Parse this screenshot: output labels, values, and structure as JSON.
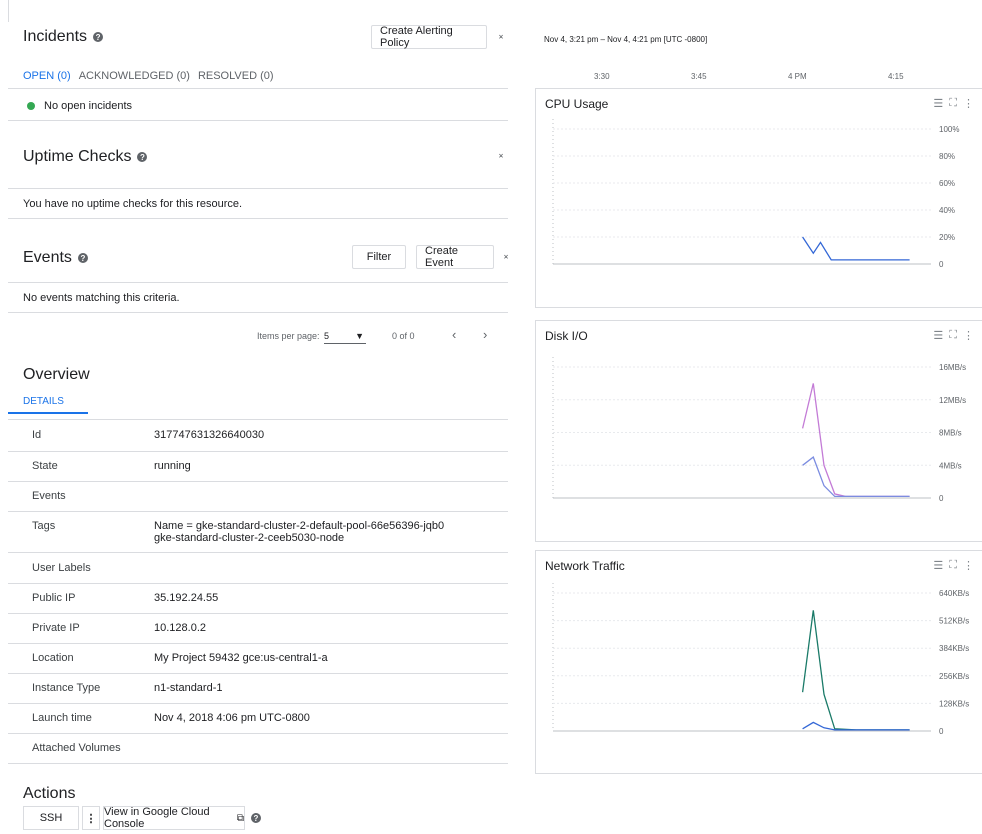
{
  "incidents": {
    "title": "Incidents",
    "create_policy_label": "Create Alerting Policy",
    "tabs": [
      "OPEN (0)",
      "ACKNOWLEDGED (0)",
      "RESOLVED (0)"
    ],
    "status_text": "No open incidents",
    "status_color": "#34a853"
  },
  "uptime": {
    "title": "Uptime Checks",
    "message": "You have no uptime checks for this resource."
  },
  "events": {
    "title": "Events",
    "filter_label": "Filter",
    "create_event_label": "Create Event",
    "message": "No events matching this criteria.",
    "pager": {
      "items_per_page_label": "Items per page:",
      "items_per_page_value": "5",
      "range": "0 of 0"
    }
  },
  "overview": {
    "title": "Overview",
    "tab": "DETAILS",
    "rows": [
      {
        "key": "Id",
        "value": "317747631326640030"
      },
      {
        "key": "State",
        "value": "running"
      },
      {
        "key": "Events",
        "value": ""
      },
      {
        "key": "Tags",
        "value": "Name = gke-standard-cluster-2-default-pool-66e56396-jqb0",
        "value2": "gke-standard-cluster-2-ceeb5030-node"
      },
      {
        "key": "User Labels",
        "value": ""
      },
      {
        "key": "Public IP",
        "value": "35.192.24.55"
      },
      {
        "key": "Private IP",
        "value": "10.128.0.2"
      },
      {
        "key": "Location",
        "value": "My Project 59432 gce:us-central1-a"
      },
      {
        "key": "Instance Type",
        "value": "n1-standard-1"
      },
      {
        "key": "Launch time",
        "value": "Nov 4, 2018 4:06 pm UTC-0800"
      },
      {
        "key": "Attached Volumes",
        "value": ""
      }
    ]
  },
  "actions": {
    "title": "Actions",
    "ssh_label": "SSH",
    "more_label": "⋮",
    "console_label": "View in Google Cloud Console"
  },
  "time_range": "Nov 4, 3:21 pm – Nov 4, 4:21 pm [UTC -0800]",
  "time_ticks": [
    "3:30",
    "3:45",
    "4 PM",
    "4:15"
  ],
  "colors": {
    "accent": "#1a73e8",
    "cpu_line": "#3367d6",
    "disk_read": "#c37bd6",
    "disk_write": "#7b8ce0",
    "net_in": "#1a7a68",
    "net_out": "#3367d6"
  },
  "chart_data": [
    {
      "type": "line",
      "title": "CPU Usage",
      "y_ticks": [
        "100%",
        "80%",
        "60%",
        "40%",
        "20%",
        "0"
      ],
      "ylim": [
        0,
        100
      ],
      "x": [
        "3:21",
        "3:30",
        "3:45",
        "4:00",
        "4:06",
        "4:08",
        "4:15",
        "4:21"
      ],
      "series": [
        {
          "points": [
            [
              4.05,
              20
            ],
            [
              4.08,
              8
            ],
            [
              4.1,
              16
            ],
            [
              4.13,
              3
            ],
            [
              4.35,
              3
            ]
          ]
        }
      ]
    },
    {
      "type": "line",
      "title": "Disk I/O",
      "y_ticks": [
        "16MB/s",
        "12MB/s",
        "8MB/s",
        "4MB/s",
        "0"
      ],
      "ylim": [
        0,
        16
      ],
      "series": [
        {
          "points": [
            [
              4.05,
              8.5
            ],
            [
              4.08,
              14
            ],
            [
              4.11,
              4
            ],
            [
              4.14,
              0.5
            ],
            [
              4.17,
              0.2
            ],
            [
              4.3,
              0.2
            ],
            [
              4.35,
              0.2
            ]
          ]
        },
        {
          "points": [
            [
              4.05,
              4
            ],
            [
              4.08,
              5
            ],
            [
              4.11,
              1.5
            ],
            [
              4.14,
              0.2
            ],
            [
              4.3,
              0.2
            ],
            [
              4.35,
              0.2
            ]
          ]
        }
      ]
    },
    {
      "type": "line",
      "title": "Network Traffic",
      "y_ticks": [
        "640KB/s",
        "512KB/s",
        "384KB/s",
        "256KB/s",
        "128KB/s",
        "0"
      ],
      "ylim": [
        0,
        640
      ],
      "series": [
        {
          "points": [
            [
              4.05,
              180
            ],
            [
              4.08,
              560
            ],
            [
              4.11,
              170
            ],
            [
              4.14,
              10
            ],
            [
              4.2,
              5
            ],
            [
              4.35,
              5
            ]
          ]
        },
        {
          "points": [
            [
              4.05,
              10
            ],
            [
              4.08,
              40
            ],
            [
              4.11,
              15
            ],
            [
              4.14,
              5
            ],
            [
              4.35,
              5
            ]
          ]
        }
      ]
    }
  ]
}
